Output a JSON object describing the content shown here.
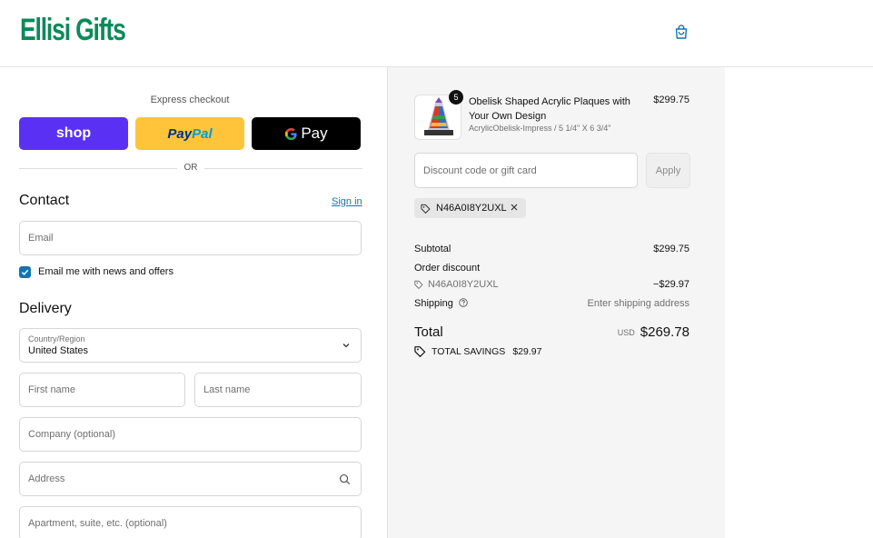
{
  "brand": {
    "name": "Ellisi Gifts",
    "color": "#0d8a5a"
  },
  "header": {
    "cart_icon": "shopping-bag-icon"
  },
  "express": {
    "label": "Express checkout",
    "shop_label": "shop",
    "paypal_label_1": "Pay",
    "paypal_label_2": "Pal",
    "gpay_label": "Pay",
    "gpay_g": "G",
    "or_label": "OR"
  },
  "contact": {
    "title": "Contact",
    "sign_in": "Sign in",
    "email_placeholder": "Email",
    "newsletter_label": "Email me with news and offers",
    "newsletter_checked": true
  },
  "delivery": {
    "title": "Delivery",
    "country_label": "Country/Region",
    "country_value": "United States",
    "first_name_placeholder": "First name",
    "last_name_placeholder": "Last name",
    "company_placeholder": "Company (optional)",
    "address_placeholder": "Address",
    "apartment_placeholder": "Apartment, suite, etc. (optional)"
  },
  "summary": {
    "product": {
      "name": "Obelisk Shaped Acrylic Plaques with Your Own Design",
      "variant": "AcrylicObelisk-Impress / 5 1/4\" X 6 3/4\"",
      "price": "$299.75",
      "quantity": "5"
    },
    "discount_placeholder": "Discount code or gift card",
    "apply_label": "Apply",
    "applied_code": "N46A0I8Y2UXL",
    "subtotal_label": "Subtotal",
    "subtotal_value": "$299.75",
    "order_discount_label": "Order discount",
    "discount_code": "N46A0I8Y2UXL",
    "discount_value": "−$29.97",
    "shipping_label": "Shipping",
    "shipping_value": "Enter shipping address",
    "total_label": "Total",
    "currency": "USD",
    "total_value": "$269.78",
    "savings_label": "TOTAL SAVINGS",
    "savings_value": "$29.97"
  },
  "colors": {
    "accent": "#1773b0",
    "shop_purple": "#5a31f4",
    "paypal_yellow": "#ffc439",
    "summary_bg": "#f5f5f5"
  }
}
